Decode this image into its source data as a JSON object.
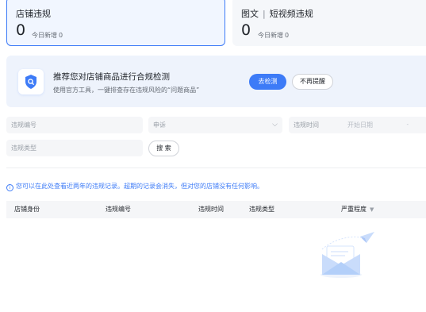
{
  "stats": [
    {
      "title": "店铺违规",
      "value": "0",
      "sub_label": "今日新增",
      "sub_value": "0"
    },
    {
      "title_a": "图文",
      "title_sep": "|",
      "title_b": "短视频违规",
      "value": "0",
      "sub_label": "今日新增",
      "sub_value": "0"
    }
  ],
  "banner": {
    "title": "推荐您对店铺商品进行合规检测",
    "description": "使用官方工具，一键排查存在违规风险的“问题商品”",
    "primary_button": "去检测",
    "secondary_button": "不再提醒"
  },
  "filters": {
    "violation_no_placeholder": "违规编号",
    "appeal_select_value": "申诉",
    "violation_time_label": "违规时间",
    "start_date_placeholder": "开始日期",
    "date_separator": "-",
    "violation_type_placeholder": "违规类型",
    "search_button": "搜 索"
  },
  "notice": "您可以在此处查看近两年的违规记录。超期的记录会消失，但对您的店铺没有任何影响。",
  "table": {
    "columns": [
      "店铺身份",
      "违规编号",
      "违规时间",
      "违规类型",
      "严重程度"
    ]
  },
  "colors": {
    "accent": "#3d7bf7",
    "banner_bg": "#eef3fc",
    "field_bg": "#f5f6f8"
  }
}
